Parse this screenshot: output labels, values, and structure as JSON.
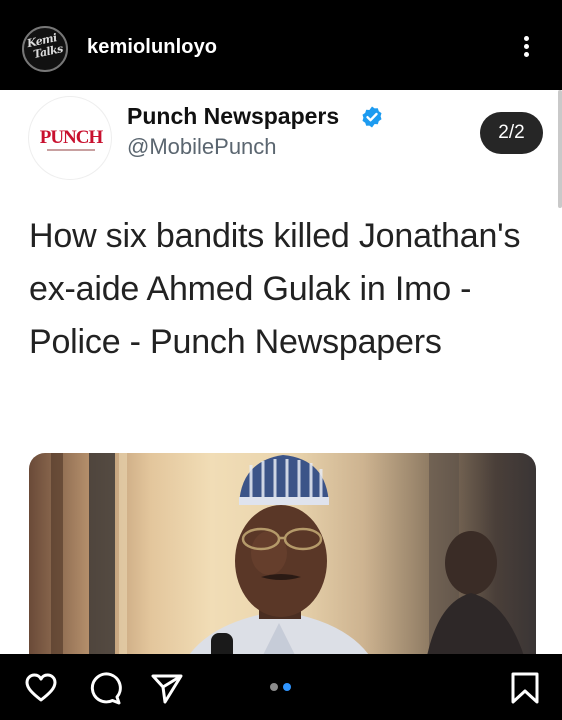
{
  "header": {
    "username": "kemiolunloyo",
    "avatar_text_1": "Kemi",
    "avatar_text_2": "Talks"
  },
  "post": {
    "page_indicator": "2/2",
    "carousel": {
      "total": 2,
      "active_index": 1
    },
    "tweet": {
      "logo_text": "PUNCH",
      "display_name": "Punch Newspapers",
      "handle": "@MobilePunch",
      "verified": true,
      "headline": "How six bandits killed Jonathan's ex-aide Ahmed Gulak in Imo - Police - Punch Newspapers"
    }
  },
  "actions": {
    "like_icon": "heart-icon",
    "comment_icon": "comment-icon",
    "share_icon": "send-icon",
    "save_icon": "bookmark-icon"
  },
  "colors": {
    "punch_red": "#c8102e",
    "verified_blue": "#1d9bf0",
    "active_dot": "#2f95ff"
  }
}
